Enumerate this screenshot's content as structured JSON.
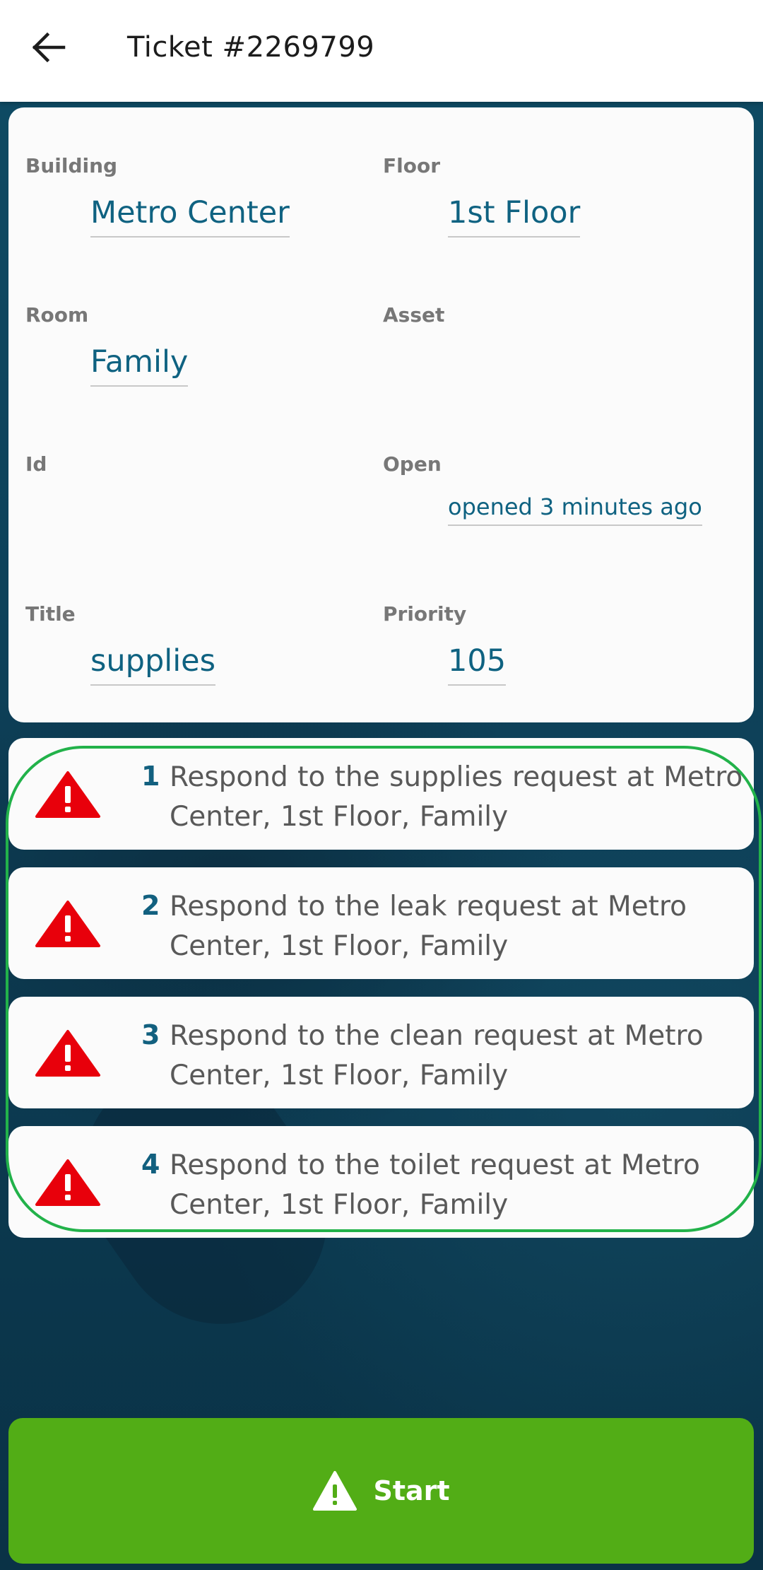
{
  "header": {
    "title": "Ticket #2269799"
  },
  "details": {
    "building_label": "Building",
    "building_value": "Metro Center",
    "floor_label": "Floor",
    "floor_value": "1st Floor",
    "room_label": "Room",
    "room_value": "Family",
    "asset_label": "Asset",
    "asset_value": "",
    "id_label": "Id",
    "id_value": "",
    "open_label": "Open",
    "open_value": "opened 3 minutes ago",
    "title_label": "Title",
    "title_value": "supplies",
    "priority_label": "Priority",
    "priority_value": "105"
  },
  "steps": [
    {
      "number": "1",
      "text": "Respond to the supplies request at Metro Center, 1st Floor, Family"
    },
    {
      "number": "2",
      "text": "Respond to the leak request at Metro Center, 1st Floor, Family"
    },
    {
      "number": "3",
      "text": "Respond to the clean request at Metro Center, 1st Floor, Family"
    },
    {
      "number": "4",
      "text": "Respond to the toilet request at Metro Center, 1st Floor, Family"
    }
  ],
  "start_button": {
    "label": "Start"
  },
  "icons": {
    "back": "arrow-left-icon",
    "warning": "warning-triangle-icon"
  },
  "colors": {
    "accent_text": "#0f6281",
    "warning": "#e8000b",
    "start_button": "#52ad16",
    "highlight": "#22b24a",
    "background": "#0c3a4f"
  }
}
